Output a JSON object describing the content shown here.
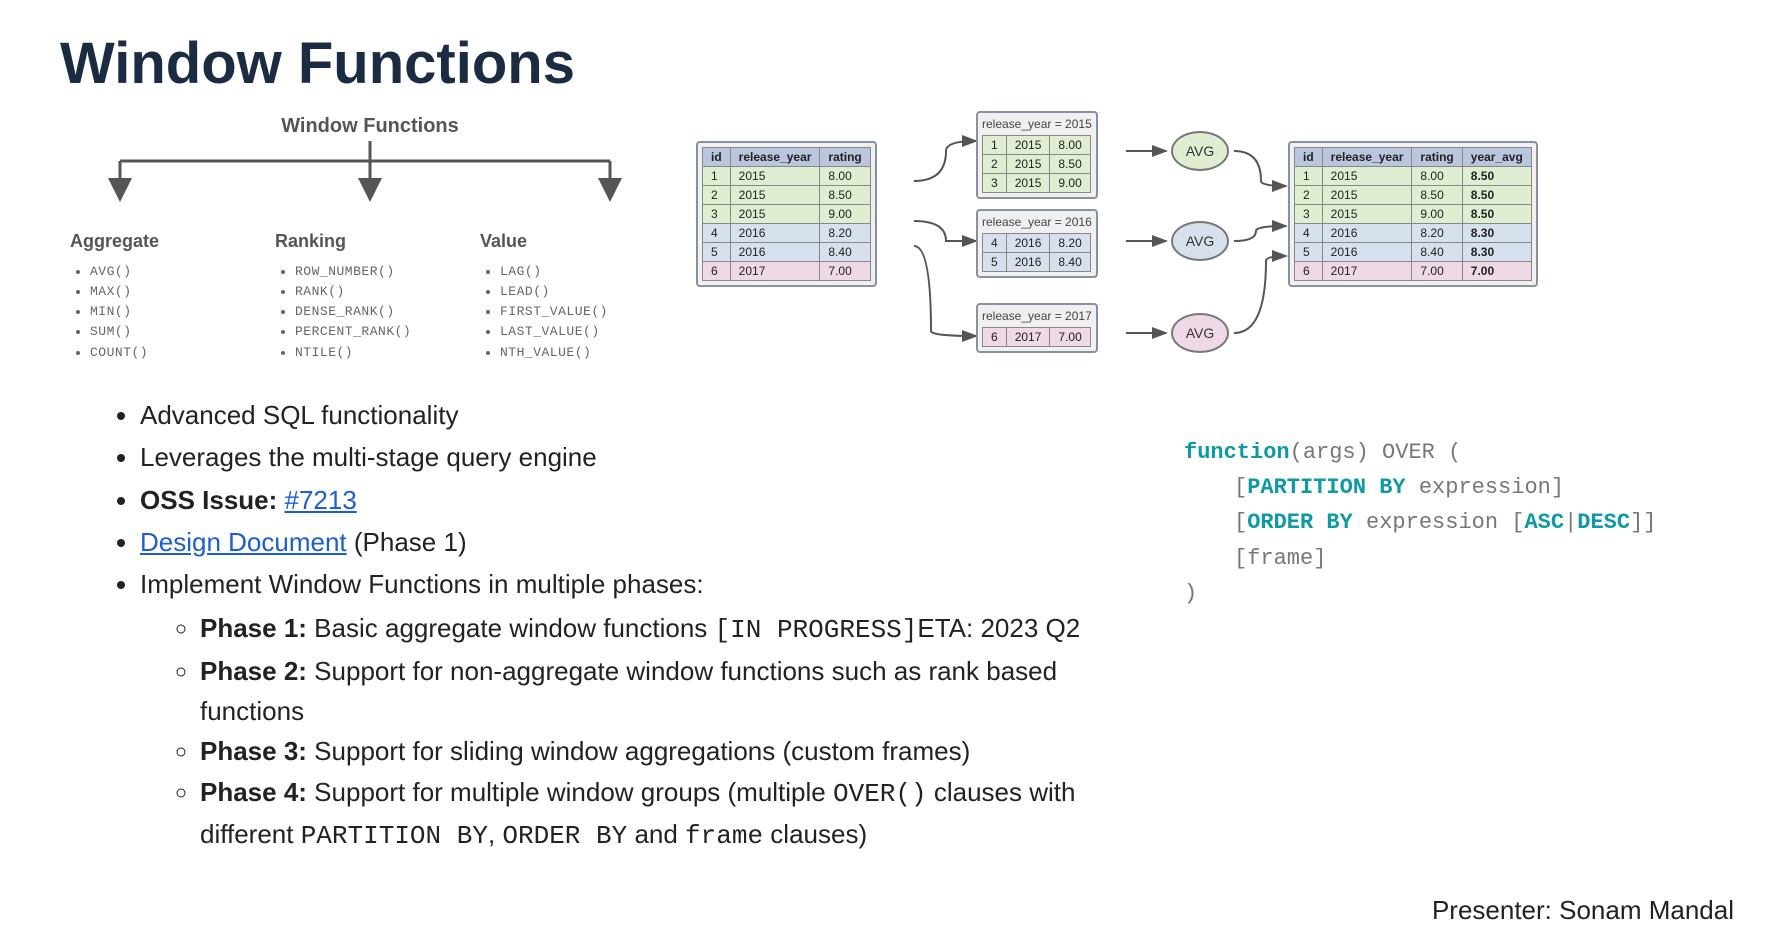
{
  "title": "Window Functions",
  "hierarchy": {
    "heading": "Window Functions",
    "aggregate": {
      "label": "Aggregate",
      "items": [
        "AVG()",
        "MAX()",
        "MIN()",
        "SUM()",
        "COUNT()"
      ]
    },
    "ranking": {
      "label": "Ranking",
      "items": [
        "ROW_NUMBER()",
        "RANK()",
        "DENSE_RANK()",
        "PERCENT_RANK()",
        "NTILE()"
      ]
    },
    "value": {
      "label": "Value",
      "items": [
        "LAG()",
        "LEAD()",
        "FIRST_VALUE()",
        "LAST_VALUE()",
        "NTH_VALUE()"
      ]
    }
  },
  "flow": {
    "input": {
      "headers": [
        "id",
        "release_year",
        "rating"
      ],
      "rows": [
        {
          "c": [
            "1",
            "2015",
            "8.00"
          ],
          "cls": "g"
        },
        {
          "c": [
            "2",
            "2015",
            "8.50"
          ],
          "cls": "g"
        },
        {
          "c": [
            "3",
            "2015",
            "9.00"
          ],
          "cls": "g"
        },
        {
          "c": [
            "4",
            "2016",
            "8.20"
          ],
          "cls": "b"
        },
        {
          "c": [
            "5",
            "2016",
            "8.40"
          ],
          "cls": "b"
        },
        {
          "c": [
            "6",
            "2017",
            "7.00"
          ],
          "cls": "p"
        }
      ]
    },
    "part2015": {
      "title": "release_year = 2015",
      "rows": [
        [
          "1",
          "2015",
          "8.00"
        ],
        [
          "2",
          "2015",
          "8.50"
        ],
        [
          "3",
          "2015",
          "9.00"
        ]
      ],
      "cls": "g"
    },
    "part2016": {
      "title": "release_year = 2016",
      "rows": [
        [
          "4",
          "2016",
          "8.20"
        ],
        [
          "5",
          "2016",
          "8.40"
        ]
      ],
      "cls": "b"
    },
    "part2017": {
      "title": "release_year = 2017",
      "rows": [
        [
          "6",
          "2017",
          "7.00"
        ]
      ],
      "cls": "p"
    },
    "avg_label": "AVG",
    "output": {
      "headers": [
        "id",
        "release_year",
        "rating",
        "year_avg"
      ],
      "rows": [
        {
          "c": [
            "1",
            "2015",
            "8.00",
            "8.50"
          ],
          "cls": "g"
        },
        {
          "c": [
            "2",
            "2015",
            "8.50",
            "8.50"
          ],
          "cls": "g"
        },
        {
          "c": [
            "3",
            "2015",
            "9.00",
            "8.50"
          ],
          "cls": "g"
        },
        {
          "c": [
            "4",
            "2016",
            "8.20",
            "8.30"
          ],
          "cls": "b"
        },
        {
          "c": [
            "5",
            "2016",
            "8.40",
            "8.30"
          ],
          "cls": "b"
        },
        {
          "c": [
            "6",
            "2017",
            "7.00",
            "7.00"
          ],
          "cls": "p"
        }
      ]
    }
  },
  "bullets": {
    "b1": "Advanced SQL functionality",
    "b2": "Leverages the multi-stage query engine",
    "b3_label": "OSS Issue: ",
    "b3_link": "#7213",
    "b4_link": "Design Document",
    "b4_suffix": " (Phase 1)",
    "b5": "Implement Window Functions in multiple phases:",
    "p1_label": "Phase 1:",
    "p1_text": " Basic aggregate window functions",
    "p1_status": "[IN PROGRESS]",
    "p1_eta": "ETA: 2023 Q2",
    "p2_label": "Phase 2:",
    "p2_text": " Support for non-aggregate window functions such as rank based functions",
    "p3_label": "Phase 3:",
    "p3_text": " Support for sliding window aggregations (custom frames)",
    "p4_label": "Phase 4:",
    "p4_text_a": " Support for multiple window groups (multiple ",
    "p4_over": "OVER()",
    "p4_text_b": " clauses with different ",
    "p4_part": "PARTITION BY",
    "p4_sep1": ", ",
    "p4_order": "ORDER BY",
    "p4_text_c": " and ",
    "p4_frame": "frame",
    "p4_text_d": " clauses)"
  },
  "syntax": {
    "l1a": "function",
    "l1b": "(args) OVER (",
    "l2a": "PARTITION BY",
    "l2b": " expression]",
    "l3a": "ORDER BY",
    "l3b": " expression [",
    "l3c": "ASC",
    "l3d": "|",
    "l3e": "DESC",
    "l3f": "]]",
    "l4": "[frame]",
    "l5": ")"
  },
  "presenter": "Presenter: Sonam Mandal"
}
